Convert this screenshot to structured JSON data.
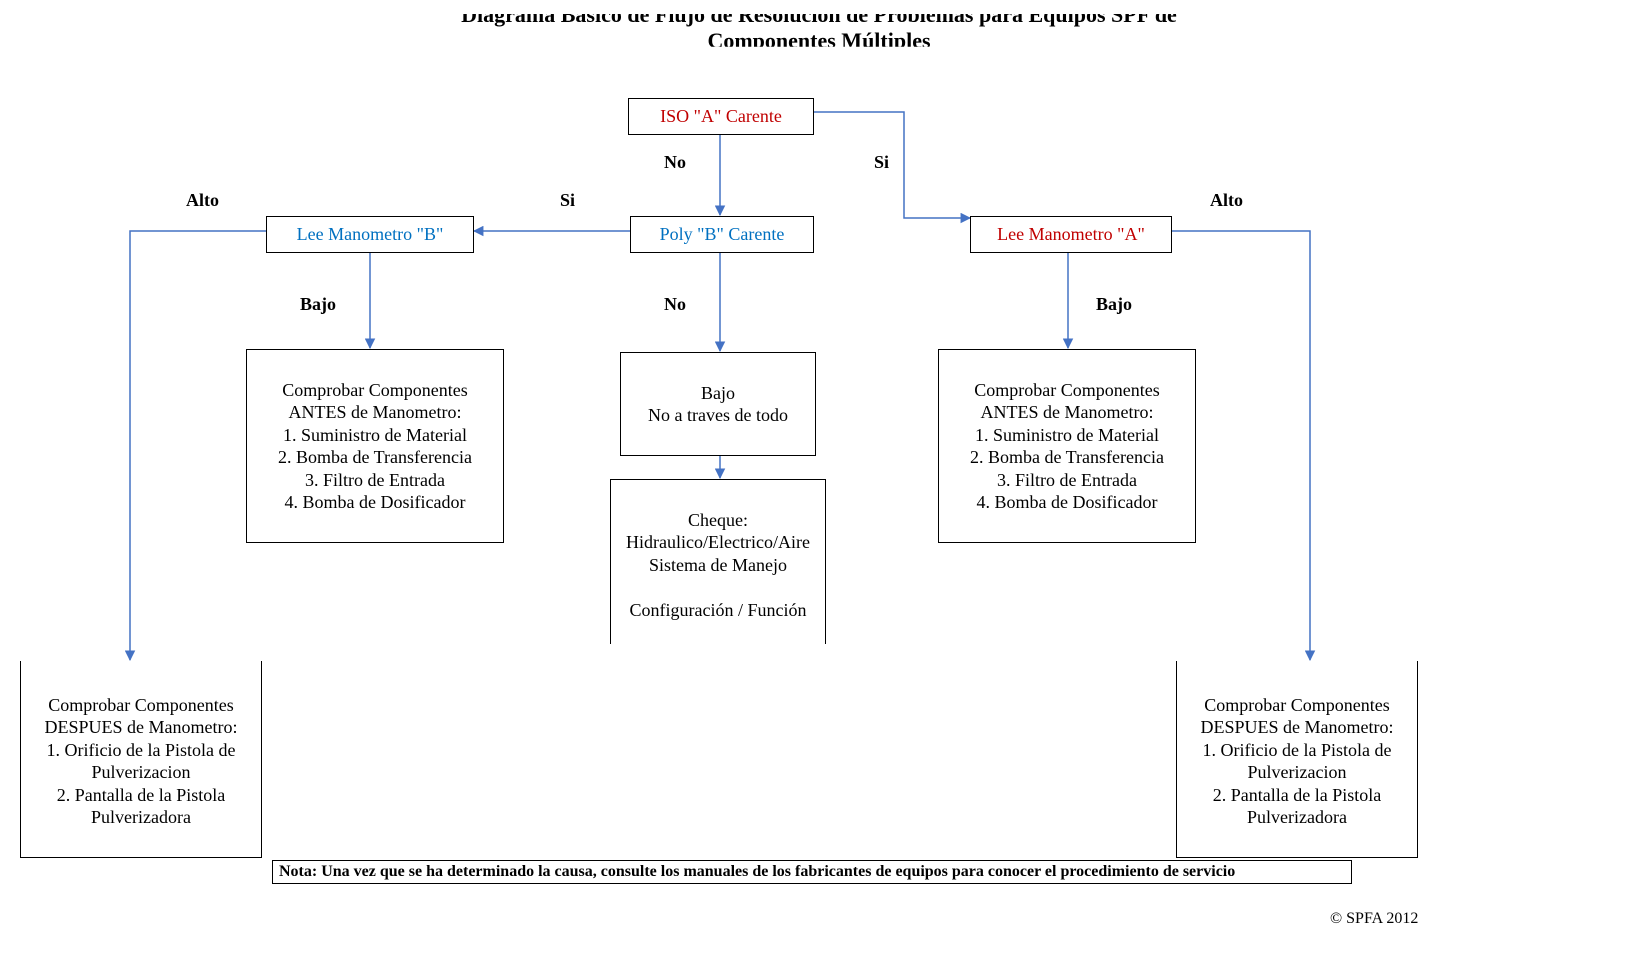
{
  "title_line1": "Diagrama Básico de Flujo de Resolución de Problemas para Equipos SPF de",
  "title_line2": "Componentes Múltiples",
  "labels": {
    "no_top": "No",
    "si_left": "Si",
    "si_right": "Si",
    "no_mid": "No",
    "alto_left": "Alto",
    "alto_right": "Alto",
    "bajo_left": "Bajo",
    "bajo_right": "Bajo"
  },
  "boxes": {
    "iso_a": "ISO \"A\" Carente",
    "poly_b": "Poly \"B\" Carente",
    "lee_b": "Lee Manometro \"B\"",
    "lee_a": "Lee Manometro \"A\"",
    "antes_b": "Comprobar Componentes ANTES de Manometro:\n1. Suministro de Material\n2. Bomba de Transferencia\n3. Filtro de Entrada\n4. Bomba de Dosificador",
    "antes_a": "Comprobar Componentes ANTES de Manometro:\n1. Suministro de Material\n2. Bomba de Transferencia\n3. Filtro de Entrada\n4. Bomba de Dosificador",
    "bajo_mid": "Bajo\nNo a traves de todo",
    "cheque": "Cheque:\nHidraulico/Electrico/Aire\nSistema de Manejo\n\nConfiguración / Función",
    "despues_b": "Comprobar Componentes DESPUES de Manometro:\n1. Orificio de la Pistola de Pulverizacion\n2. Pantalla de la Pistola Pulverizadora",
    "despues_a": "Comprobar Componentes DESPUES de Manometro:\n1. Orificio de la Pistola de Pulverizacion\n2. Pantalla de la Pistola Pulverizadora"
  },
  "note": "Nota: Una vez que se ha determinado la causa, consulte los manuales de los fabricantes de equipos para conocer el procedimiento de servicio",
  "copyright": "© SPFA 2012"
}
